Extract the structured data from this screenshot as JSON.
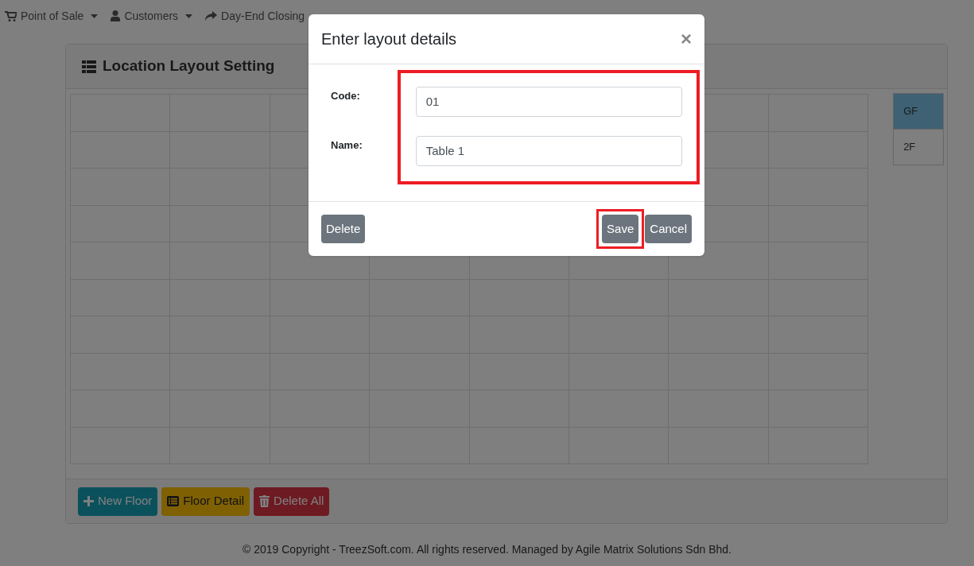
{
  "nav": [
    {
      "label": "Point of Sale",
      "dropdown": true
    },
    {
      "label": "Customers",
      "dropdown": true
    },
    {
      "label": "Day-End Closing",
      "dropdown": false
    }
  ],
  "card": {
    "title": "Location Layout Setting",
    "floors": [
      {
        "label": "GF",
        "selected": true
      },
      {
        "label": "2F",
        "selected": false
      }
    ],
    "buttons": [
      {
        "label": "New Floor",
        "kind": "add"
      },
      {
        "label": "Floor Detail",
        "kind": "detail"
      },
      {
        "label": "Delete All",
        "kind": "delete"
      }
    ]
  },
  "footer": "© 2019 Copyright - TreezSoft.com. All rights reserved. Managed by Agile Matrix Solutions Sdn Bhd.",
  "modal": {
    "title": "Enter layout details",
    "close": "×",
    "fields_highlighted": true,
    "fields": [
      {
        "label": "Code:",
        "value": "01"
      },
      {
        "label": "Name:",
        "value": "Table 1"
      }
    ],
    "left_button": {
      "label": "Delete",
      "highlighted": false
    },
    "right_buttons": [
      {
        "label": "Save",
        "highlighted": true
      },
      {
        "label": "Cancel",
        "highlighted": false
      }
    ]
  }
}
